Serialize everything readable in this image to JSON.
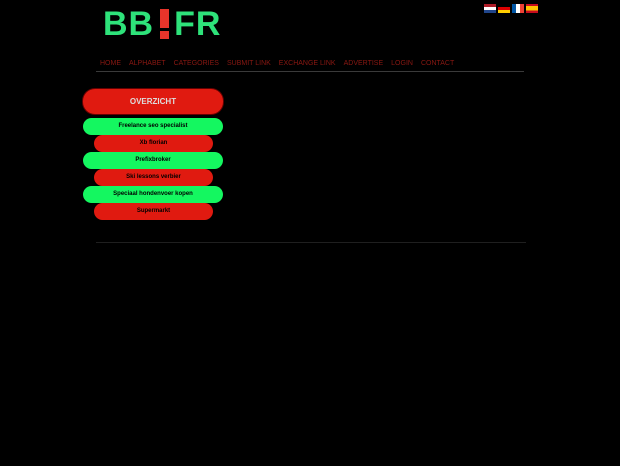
{
  "logo": {
    "left": "BB",
    "right": "FR"
  },
  "languages": [
    {
      "code": "nl",
      "icon": "flag-nl-icon"
    },
    {
      "code": "de",
      "icon": "flag-de-icon"
    },
    {
      "code": "fr",
      "icon": "flag-fr-icon"
    },
    {
      "code": "es",
      "icon": "flag-es-icon"
    }
  ],
  "nav": {
    "items": [
      "HOME",
      "ALPHABET",
      "CATEGORIES",
      "SUBMIT LINK",
      "EXCHANGE LINK",
      "ADVERTISE",
      "LOGIN",
      "CONTACT"
    ]
  },
  "sidebar": {
    "title": "OVERZICHT",
    "items": [
      {
        "label": "Freelance seo specialist",
        "color": "#14f760"
      },
      {
        "label": "Xb florian",
        "color": "#e01a10"
      },
      {
        "label": "Prefixbroker",
        "color": "#14f760"
      },
      {
        "label": "Ski lessons verbier",
        "color": "#e01a10"
      },
      {
        "label": "Speciaal hondenvoer kopen",
        "color": "#14f760"
      },
      {
        "label": "Supermarkt",
        "color": "#e01a10"
      }
    ]
  },
  "colors": {
    "accent_green": "#14f760",
    "accent_red": "#e01a10",
    "background": "#000000"
  }
}
